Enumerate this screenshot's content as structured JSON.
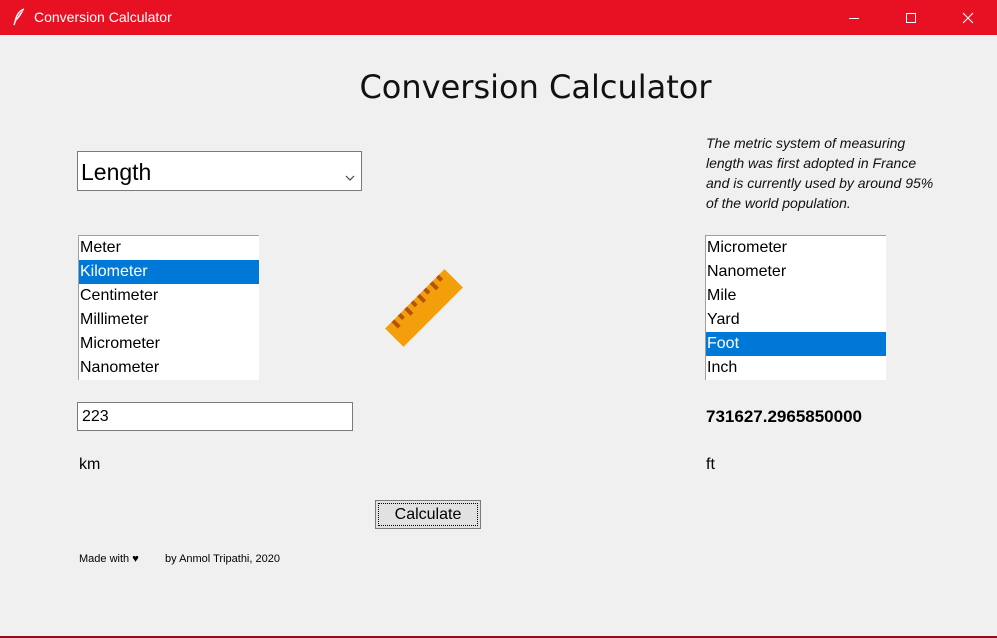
{
  "window": {
    "title": "Conversion Calculator",
    "icon": "feather-icon",
    "titlebar_color": "#e81123",
    "controls": {
      "minimize": "minimize-icon",
      "maximize": "maximize-icon",
      "close": "close-icon"
    }
  },
  "heading": "Conversion Calculator",
  "category": {
    "selected": "Length",
    "icon": "chevron-down-icon"
  },
  "fact": "The metric system of measuring length was first adopted in France and is currently used by around 95% of the world population.",
  "from_list": {
    "items": [
      "Meter",
      "Kilometer",
      "Centimeter",
      "Millimeter",
      "Micrometer",
      "Nanometer"
    ],
    "selected": "Kilometer"
  },
  "to_list": {
    "items": [
      "Micrometer",
      "Nanometer",
      "Mile",
      "Yard",
      "Foot",
      "Inch"
    ],
    "selected": "Foot"
  },
  "selection_color": "#0078d7",
  "center_icon": {
    "name": "ruler-icon",
    "color": "#f59e0b"
  },
  "input": {
    "value": "223"
  },
  "result": "731627.2965850000",
  "from_unit": "km",
  "to_unit": "ft",
  "calculate_label": "Calculate",
  "footer": {
    "made_with": "Made with ♥",
    "credit": "by Anmol Tripathi, 2020"
  }
}
